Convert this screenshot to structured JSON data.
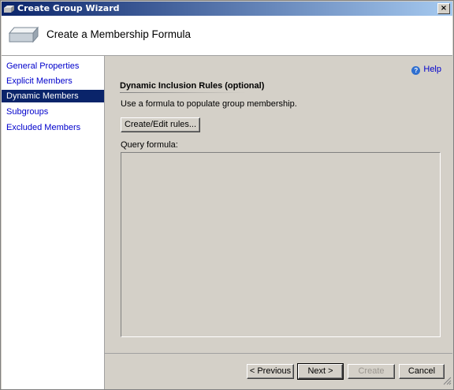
{
  "window": {
    "title": "Create Group Wizard",
    "close_glyph": "×"
  },
  "header": {
    "title": "Create a Membership Formula",
    "icon": "wizard-banner-icon"
  },
  "nav": {
    "items": [
      {
        "label": "General Properties",
        "selected": false
      },
      {
        "label": "Explicit Members",
        "selected": false
      },
      {
        "label": "Dynamic Members",
        "selected": true
      },
      {
        "label": "Subgroups",
        "selected": false
      },
      {
        "label": "Excluded Members",
        "selected": false
      }
    ]
  },
  "content": {
    "help_label": "Help",
    "help_glyph": "?",
    "section_title": "Dynamic Inclusion Rules (optional)",
    "description": "Use a formula to populate group membership.",
    "create_edit_button": "Create/Edit rules...",
    "query_label": "Query formula:",
    "query_value": ""
  },
  "footer": {
    "previous_label": "< Previous",
    "next_label": "Next >",
    "create_label": "Create",
    "cancel_label": "Cancel"
  },
  "colors": {
    "selection": "#0a246a",
    "link": "#0000cc",
    "face": "#d4d0c8"
  }
}
